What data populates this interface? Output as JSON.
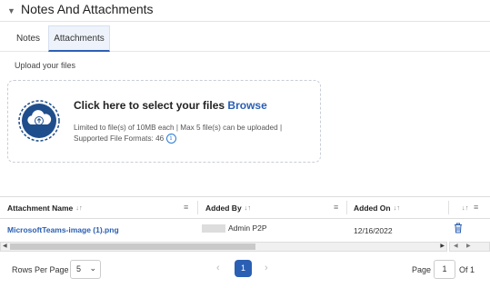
{
  "section": {
    "title": "Notes And Attachments"
  },
  "tabs": [
    {
      "label": "Notes"
    },
    {
      "label": "Attachments",
      "active": true
    }
  ],
  "upload": {
    "label": "Upload your files",
    "main_text": "Click here to select your files",
    "browse": "Browse",
    "limits_line1": "Limited to file(s) of 10MB each | Max 5 file(s) can be uploaded |",
    "limits_line2": "Supported File Formats: 46",
    "info": "i"
  },
  "table": {
    "columns": [
      {
        "label": "Attachment Name",
        "sort": "↓↑",
        "menu": "≡"
      },
      {
        "label": "Added By",
        "sort": "↓↑",
        "menu": "≡"
      },
      {
        "label": "Added On",
        "sort": "↓↑"
      },
      {
        "label": "",
        "sort": "↓↑",
        "menu": "≡"
      }
    ],
    "rows": [
      {
        "name": "MicrosoftTeams-image (1).png",
        "added_by": "Admin P2P",
        "added_on": "12/16/2022"
      }
    ]
  },
  "pagination": {
    "rows_per_page_label": "Rows Per Page",
    "rows_per_page": "5",
    "current_page": "1",
    "page_label": "Page",
    "page_input": "1",
    "of_label": "Of 1"
  },
  "colors": {
    "accent": "#2a5fb3",
    "cloud": "#1f4e8c"
  }
}
